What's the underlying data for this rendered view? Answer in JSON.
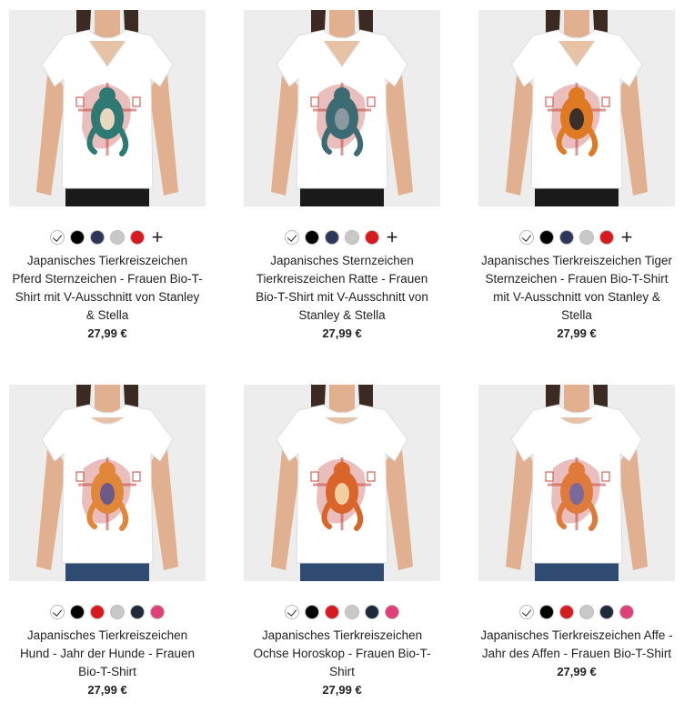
{
  "products": [
    {
      "title": "Japanisches Tierkreiszeichen Pferd Sternzeichen - Frauen Bio-T-Shirt mit V-Ausschnitt von Stanley & Stella",
      "price": "27,99 €",
      "more_label": "+",
      "colors": [
        "#ffffff",
        "#000000",
        "#2d3659",
        "#c8c8c8",
        "#d71920"
      ],
      "shirt_style": "v-neck",
      "design": "horse",
      "design_colors": [
        "#2e7a73",
        "#c4453e",
        "#e8d8c0"
      ]
    },
    {
      "title": "Japanisches Sternzeichen Tierkreiszeichen Ratte - Frauen Bio-T-Shirt mit V-Ausschnitt von Stanley & Stella",
      "price": "27,99 €",
      "more_label": "+",
      "colors": [
        "#ffffff",
        "#000000",
        "#2d3659",
        "#c8c8c8",
        "#d71920"
      ],
      "shirt_style": "v-neck",
      "design": "rat",
      "design_colors": [
        "#3d6b74",
        "#c4453e",
        "#8a9aa0"
      ]
    },
    {
      "title": "Japanisches Tierkreiszeichen Tiger Sternzeichen - Frauen Bio-T-Shirt mit V-Ausschnitt von Stanley & Stella",
      "price": "27,99 €",
      "more_label": "+",
      "colors": [
        "#ffffff",
        "#000000",
        "#2d3659",
        "#c8c8c8",
        "#d71920"
      ],
      "shirt_style": "v-neck",
      "design": "tiger",
      "design_colors": [
        "#e07a22",
        "#c4453e",
        "#3a2e2a"
      ]
    },
    {
      "title": "Japanisches Tierkreiszeichen Hund - Jahr der Hunde - Frauen Bio-T-Shirt",
      "price": "27,99 €",
      "more_label": "",
      "colors": [
        "#ffffff",
        "#000000",
        "#d71920",
        "#c8c8c8",
        "#1e2a3c",
        "#e0407a"
      ],
      "shirt_style": "crew",
      "design": "dog",
      "design_colors": [
        "#e0873a",
        "#c4453e",
        "#6b5a8a"
      ]
    },
    {
      "title": "Japanisches Tierkreiszeichen Ochse Horoskop - Frauen Bio-T-Shirt",
      "price": "27,99 €",
      "more_label": "",
      "colors": [
        "#ffffff",
        "#000000",
        "#d71920",
        "#c8c8c8",
        "#1e2a3c",
        "#e0407a"
      ],
      "shirt_style": "crew",
      "design": "ox",
      "design_colors": [
        "#d9652a",
        "#c4453e",
        "#f0d0a0"
      ]
    },
    {
      "title": "Japanisches Tierkreiszeichen Affe - Jahr des Affen - Frauen Bio-T-Shirt",
      "price": "27,99 €",
      "more_label": "",
      "colors": [
        "#ffffff",
        "#000000",
        "#d71920",
        "#c8c8c8",
        "#1e2a3c",
        "#e0407a"
      ],
      "shirt_style": "crew",
      "design": "monkey",
      "design_colors": [
        "#e07a3a",
        "#c4453e",
        "#7a6a9a"
      ]
    }
  ]
}
